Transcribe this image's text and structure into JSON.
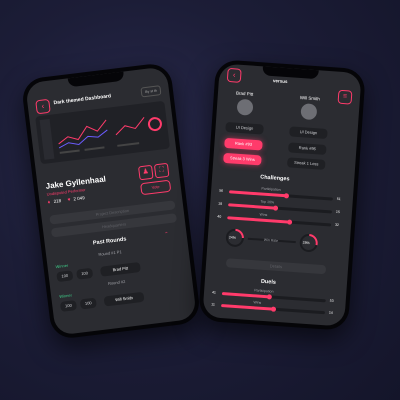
{
  "left": {
    "header_title": "Dark themed Dashboard",
    "header_badge": "By st th",
    "name": "Jake Gyllenhaal",
    "subtitle": "Undisputed Performer",
    "stat1": "218",
    "stat2": "2 049",
    "vote_label": "Vote",
    "tab1": "Project Description",
    "tab2": "Headquarters",
    "section_title": "Past Rounds",
    "round_label": "Round #1 P1",
    "winner_label": "Winner",
    "opponent1": "Brad Pitt",
    "round2_label": "Round #2",
    "winner2_label": "Winner",
    "opponent2": "Will Smith",
    "score1": "100",
    "score2": "100",
    "score3": "100",
    "score4": "100"
  },
  "right": {
    "header_title": "versus",
    "player1": "Brad Pitt",
    "player2": "Will Smith",
    "p1_tag1": "UI Design",
    "p1_tag2": "Rank #93",
    "p1_tag3": "Streak 3 Wins",
    "p2_tag1": "UI Design",
    "p2_tag2": "Rank #96",
    "p2_tag3": "Streak 1 Loss",
    "challenges_title": "Challenges",
    "ch_rows": [
      {
        "label": "Participation",
        "left": "56",
        "right": "51",
        "fill": 0.55
      },
      {
        "label": "Top 10%",
        "left": "18",
        "right": "15",
        "fill": 0.45
      },
      {
        "label": "Wins",
        "left": "40",
        "right": "32",
        "fill": 0.6
      }
    ],
    "ring_left": "24%",
    "ring_mid": "Win Rate",
    "ring_right": "28%",
    "ring_left_val": 0.24,
    "ring_right_val": 0.28,
    "details_label": "Details",
    "duels_title": "Duels",
    "duel_rows": [
      {
        "label": "Participation",
        "left": "41",
        "right": "53",
        "fill": 0.45
      },
      {
        "label": "Wins",
        "left": "11",
        "right": "14",
        "fill": 0.5
      }
    ]
  },
  "colors": {
    "accent": "#ff3b6b",
    "screen": "#2b2c31",
    "card": "#1f2024"
  }
}
